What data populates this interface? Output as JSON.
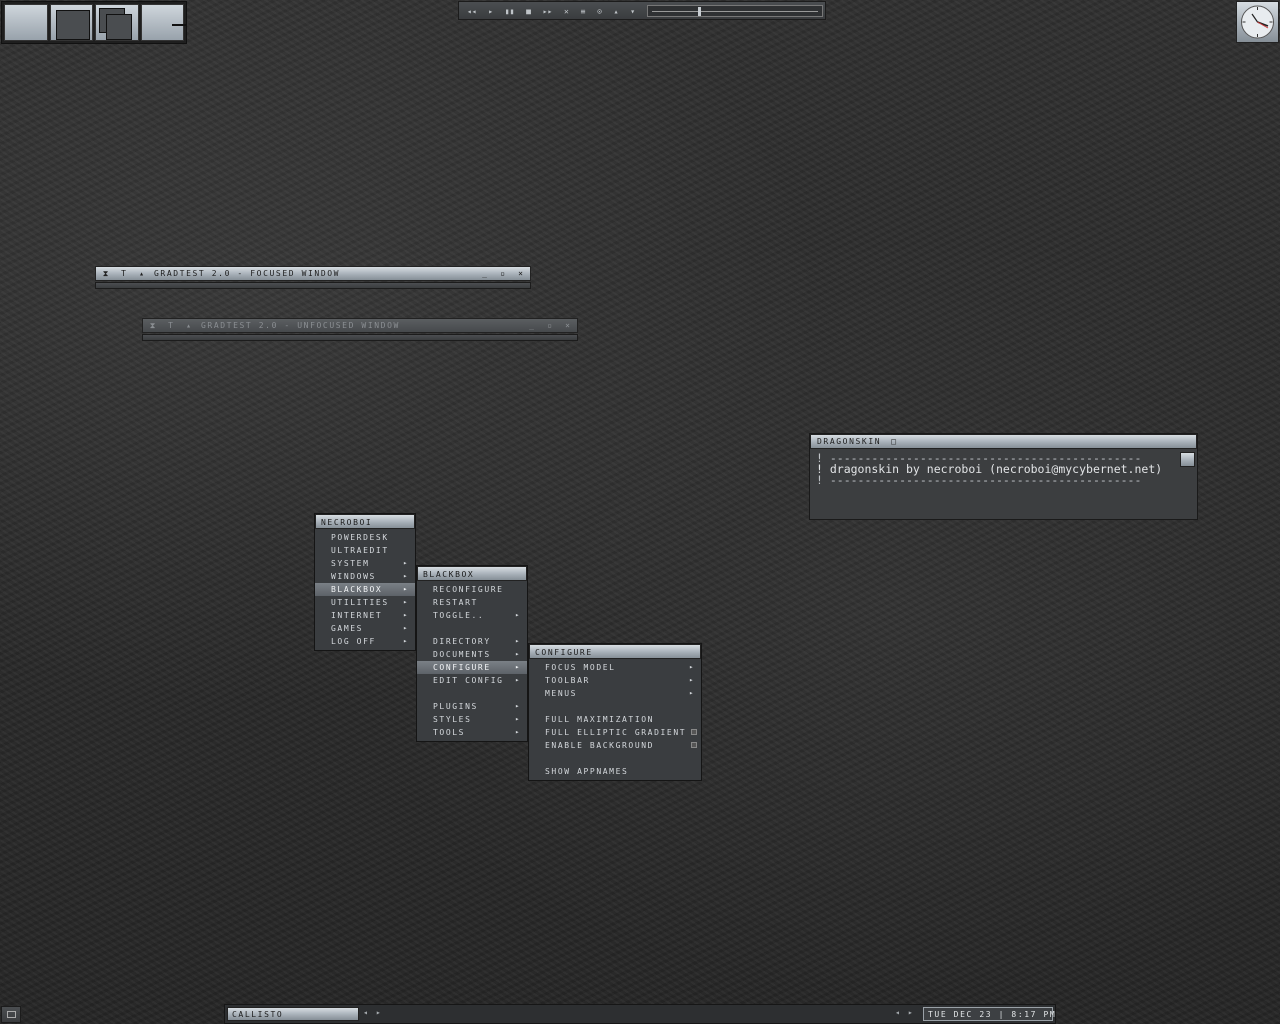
{
  "toolbar_top": {
    "media_controls": [
      "◂◂",
      "▸",
      "▮▮",
      "■",
      "▸▸",
      "✕",
      "≡",
      "⊙",
      "▴",
      "▾"
    ],
    "volume_level_fraction": 0.28
  },
  "windows": {
    "focused": {
      "title": "GRADTEST 2.0 - FOCUSED WINDOW"
    },
    "unfocused": {
      "title": "GRADTEST 2.0 - UNFOCUSED WINDOW"
    },
    "buttons": {
      "iconify": "_",
      "maximize": "▫",
      "close": "×",
      "shade": "▴",
      "stick": "T",
      "menu": "⧗"
    }
  },
  "dragonskin": {
    "title": "DRAGONSKIN",
    "title_icon": "□",
    "lines": [
      "! ---------------------------------------------",
      "! dragonskin by necroboi (necroboi@mycybernet.net)",
      "! ---------------------------------------------"
    ]
  },
  "menu_root": {
    "title": "NECROBOI",
    "items": [
      {
        "label": "POWERDESK",
        "arrow": ""
      },
      {
        "label": "ULTRAEDIT",
        "arrow": ""
      },
      {
        "label": "SYSTEM",
        "arrow": "▸"
      },
      {
        "label": "WINDOWS",
        "arrow": "▸"
      },
      {
        "label": "BLACKBOX",
        "arrow": "▸"
      },
      {
        "label": "UTILITIES",
        "arrow": "▸"
      },
      {
        "label": "INTERNET",
        "arrow": "▸"
      },
      {
        "label": "GAMES",
        "arrow": "▸"
      },
      {
        "label": "LOG OFF",
        "arrow": "▸"
      }
    ]
  },
  "menu_blackbox": {
    "title": "BLACKBOX",
    "items": [
      {
        "label": "RECONFIGURE",
        "arrow": ""
      },
      {
        "label": "RESTART",
        "arrow": ""
      },
      {
        "label": "TOGGLE..",
        "arrow": "▸"
      },
      {
        "label": "",
        "arrow": ""
      },
      {
        "label": "DIRECTORY",
        "arrow": "▸"
      },
      {
        "label": "DOCUMENTS",
        "arrow": "▸"
      },
      {
        "label": "CONFIGURE",
        "arrow": "▸"
      },
      {
        "label": "EDIT CONFIG",
        "arrow": "▸"
      },
      {
        "label": "",
        "arrow": ""
      },
      {
        "label": "PLUGINS",
        "arrow": "▸"
      },
      {
        "label": "STYLES",
        "arrow": "▸"
      },
      {
        "label": "TOOLS",
        "arrow": "▸"
      }
    ]
  },
  "menu_configure": {
    "title": "CONFIGURE",
    "items": [
      {
        "label": "FOCUS MODEL",
        "arrow": "▸"
      },
      {
        "label": "TOOLBAR",
        "arrow": "▸"
      },
      {
        "label": "MENUS",
        "arrow": "▸"
      },
      {
        "label": "",
        "arrow": ""
      },
      {
        "label": "FULL MAXIMIZATION",
        "arrow": ""
      },
      {
        "label": "FULL ELLIPTIC GRADIENT",
        "arrow": ""
      },
      {
        "label": "ENABLE BACKGROUND",
        "arrow": ""
      },
      {
        "label": "",
        "arrow": ""
      },
      {
        "label": "SHOW APPNAMES",
        "arrow": ""
      }
    ]
  },
  "taskbar": {
    "workspace": "CALLISTO",
    "nav_left": "◂ ▸",
    "nav_right": "◂ ▸",
    "clock": "TUE DEC 23 | 8:17 PM"
  }
}
